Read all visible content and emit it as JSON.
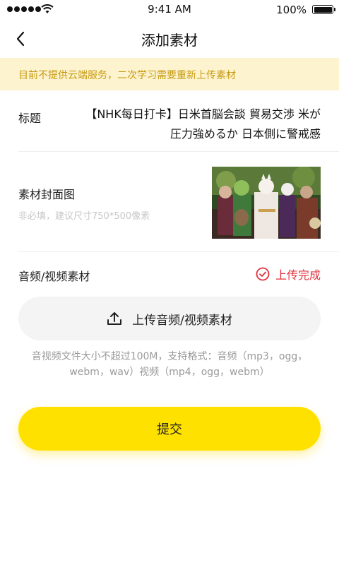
{
  "status_bar": {
    "time": "9:41 AM",
    "battery": "100%"
  },
  "nav": {
    "title": "添加素材",
    "back_icon": "chevron-left-icon"
  },
  "notice": {
    "text": "目前不提供云端服务，二次学习需要重新上传素材"
  },
  "form": {
    "title_label": "标题",
    "title_value": "【NHK每日打卡】日米首脳会談 貿易交渉 米が圧力強めるか 日本側に警戒感",
    "cover_label": "素材封面图",
    "cover_hint": "非必填，建议尺寸750*500像素",
    "media_label": "音频/视频素材",
    "upload_status": "上传完成",
    "upload_status_color": "#e0323c",
    "upload_button": "上传音频/视频素材",
    "format_hint": "音视频文件大小不超过100M，支持格式：音频（mp3，ogg，webm，wav）视频（mp4，ogg，webm）"
  },
  "submit": {
    "label": "提交",
    "color": "#ffe100"
  },
  "theme": {
    "notice_bg": "#fdf4cf",
    "notice_text": "#c89a12"
  }
}
